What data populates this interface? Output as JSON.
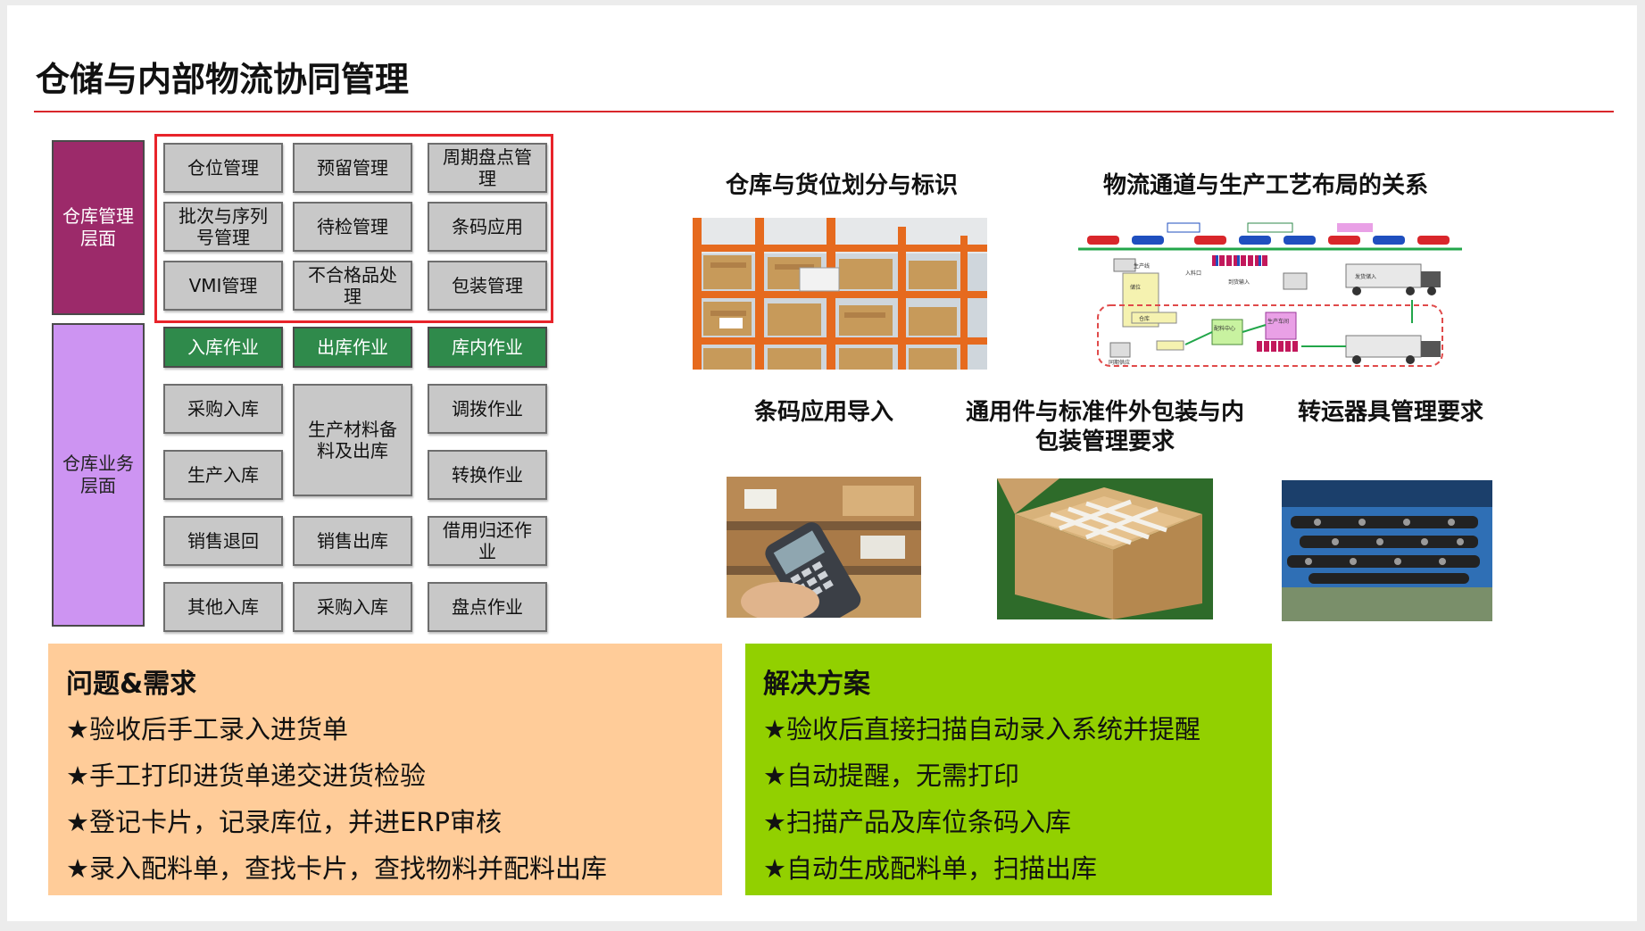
{
  "title": "仓储与内部物流协同管理",
  "left": {
    "categories": [
      "仓库管理\n层面",
      "仓库业务\n层面"
    ],
    "management_boxes": [
      "仓位管理",
      "预留管理",
      "周期盘点管\n理",
      "批次与序列\n号管理",
      "待检管理",
      "条码应用",
      "VMI管理",
      "不合格品处\n理",
      "包装管理"
    ],
    "ops_headers": [
      "入库作业",
      "出库作业",
      "库内作业"
    ],
    "ops_boxes": [
      "采购入库",
      "生产材料备\n料及出库",
      "调拨作业",
      "生产入库",
      "转换作业",
      "销售退回",
      "销售出库",
      "借用归还作\n业",
      "其他入库",
      "采购入库",
      "盘点作业"
    ]
  },
  "captions": {
    "warehouse_zones": "仓库与货位划分与标识",
    "logistics_layout": "物流通道与生产工艺布局的关系",
    "barcode": "条码应用导入",
    "packaging": "通用件与标准件外包装与内\n包装管理要求",
    "transfer": "转运器具管理要求"
  },
  "diagram_labels": [
    "生产线",
    "储位",
    "入料口",
    "到货输入",
    "仓库",
    "配料中心",
    "生产车间",
    "同期供应",
    "发货储入"
  ],
  "problems": {
    "heading": "问题&需求",
    "items": [
      "★验收后手工录入进货单",
      "★手工打印进货单递交进货检验",
      "★登记卡片，记录库位，并进ERP审核",
      "★录入配料单，查找卡片，查找物料并配料出库"
    ]
  },
  "solutions": {
    "heading": "解决方案",
    "items": [
      "★验收后直接扫描自动录入系统并提醒",
      "★自动提醒，无需打印",
      "★扫描产品及库位条码入库",
      "★自动生成配料单，扫描出库"
    ]
  },
  "colors": {
    "title_rule": "#d9262b",
    "mgmt_category": "#9c2a6a",
    "ops_category": "#cd94f2",
    "ops_header": "#2f8a4b",
    "box": "#c8c8c8",
    "problem_panel": "#ffcc99",
    "solution_panel": "#92d000"
  }
}
